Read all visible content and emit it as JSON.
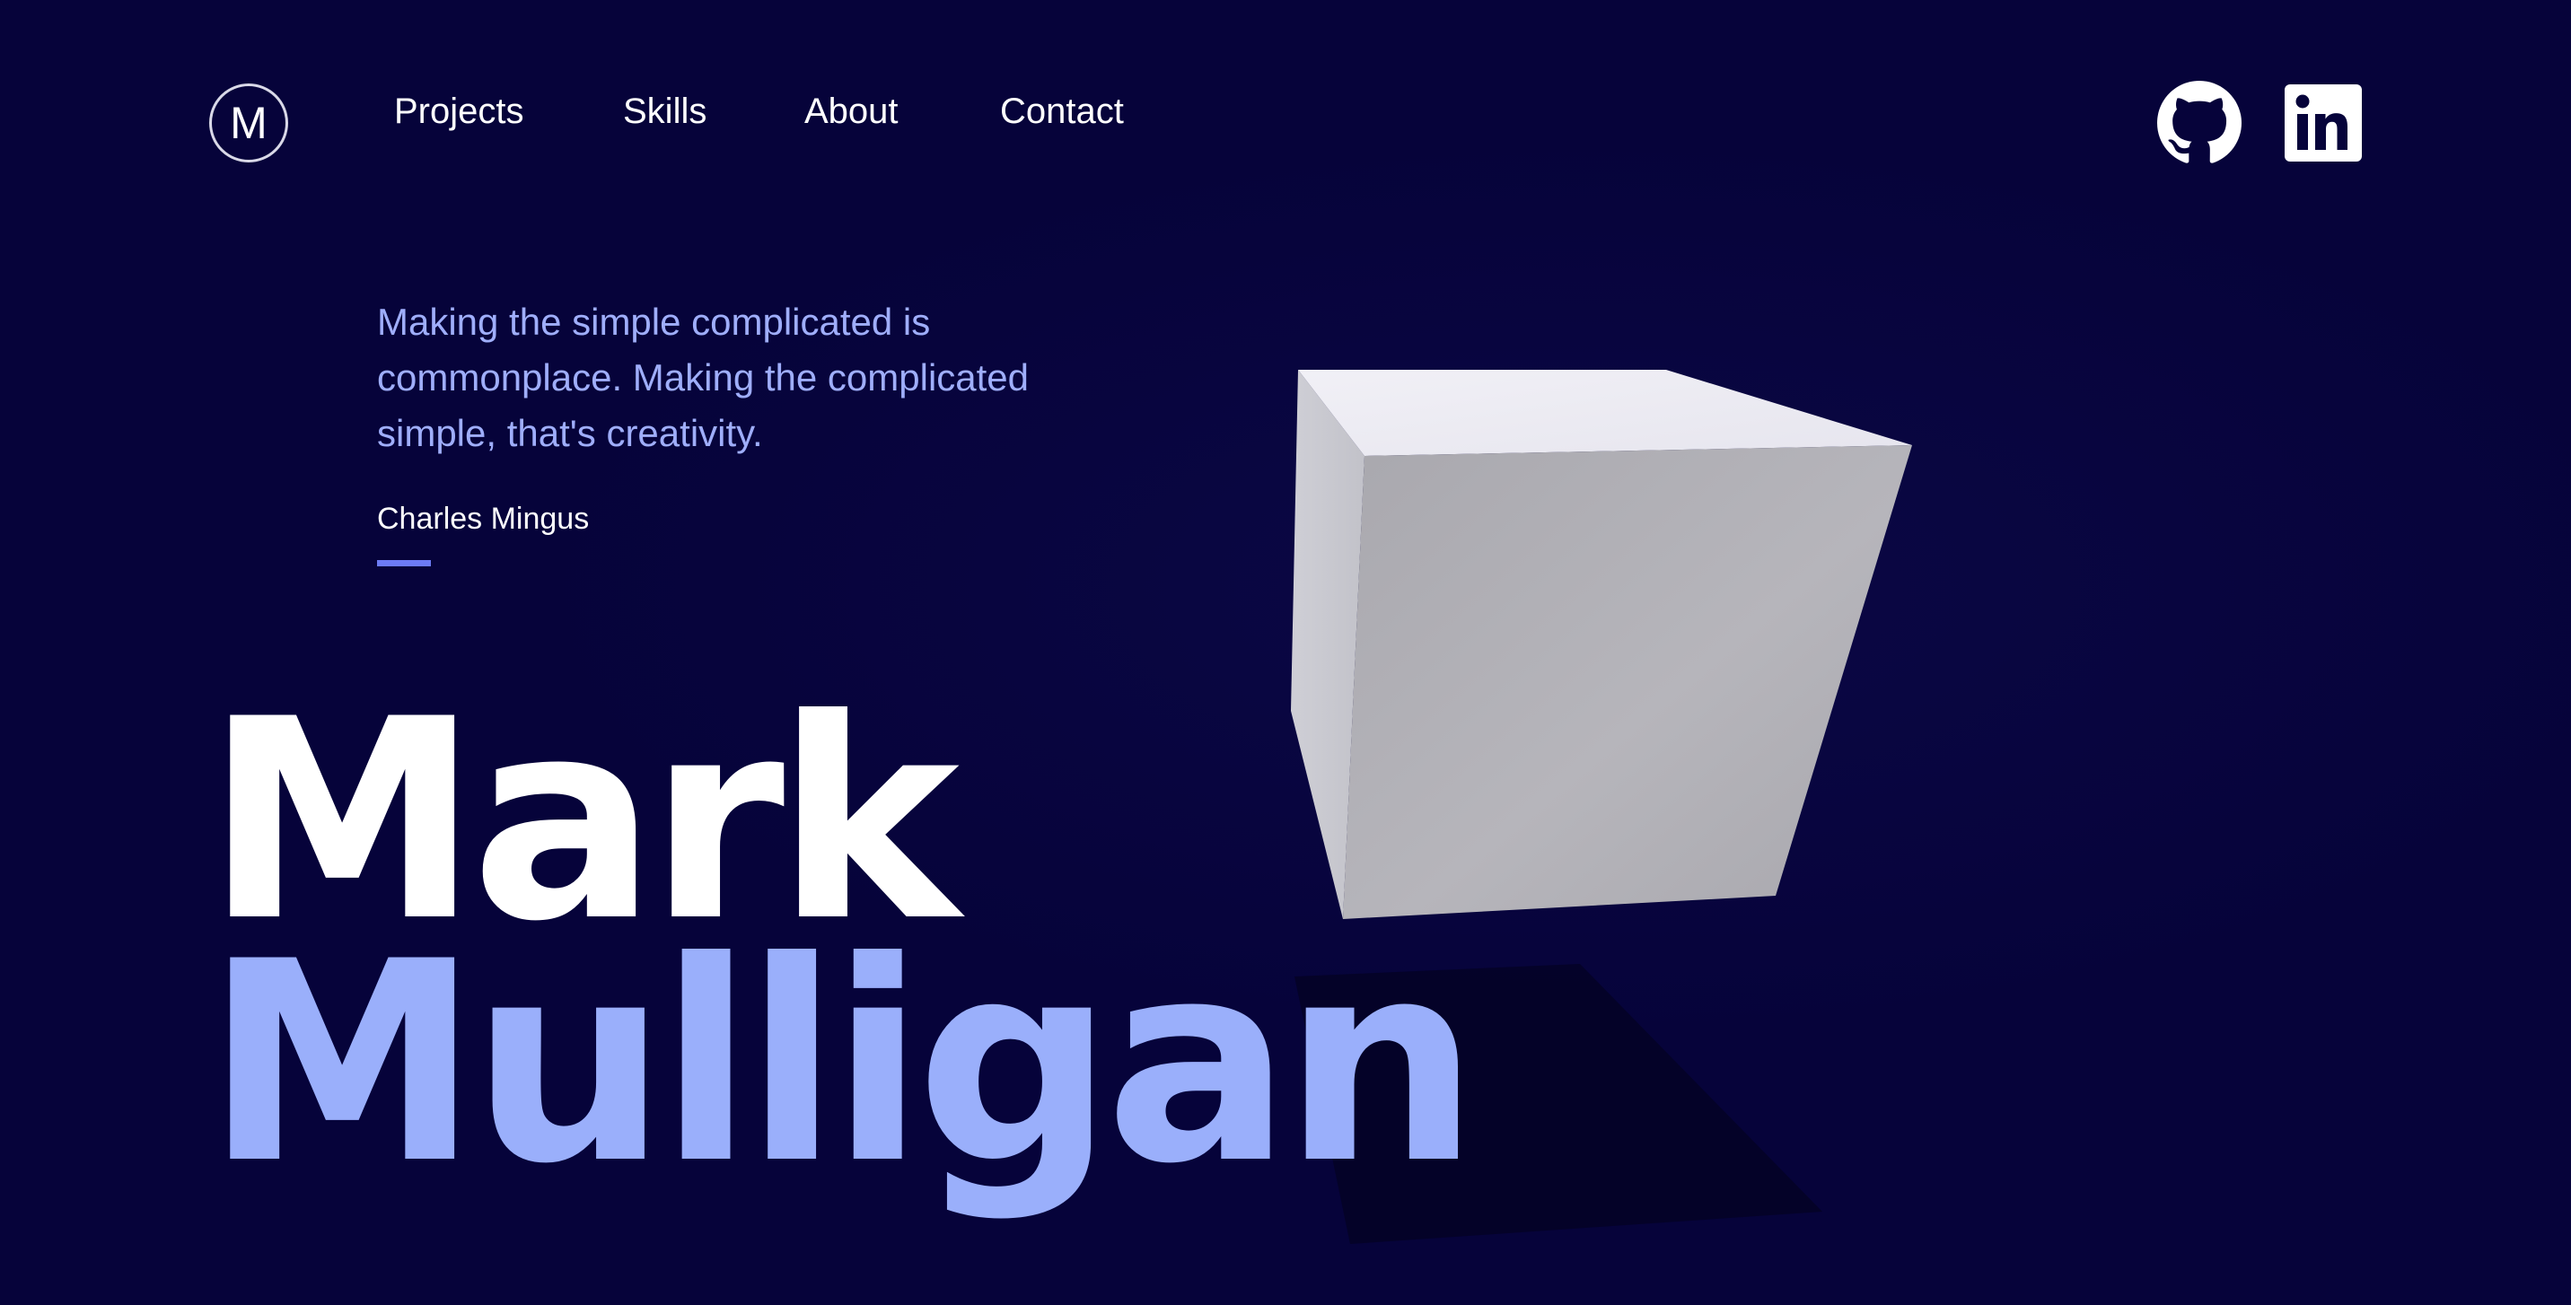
{
  "header": {
    "logo_letter": "M",
    "nav": {
      "projects": "Projects",
      "skills": "Skills",
      "about": "About",
      "contact": "Contact"
    },
    "social": [
      {
        "icon": "github-icon"
      },
      {
        "icon": "linkedin-icon"
      }
    ]
  },
  "hero": {
    "quote": "Making the simple complicated is commonplace. Making the complicated simple, that's creativity.",
    "author": "Charles Mingus",
    "first_name": "Mark",
    "last_name": "Mulligan"
  },
  "colors": {
    "background": "#06033a",
    "accent": "#9aaffb",
    "accent_rule": "#6c7bf5",
    "text": "#ffffff"
  }
}
